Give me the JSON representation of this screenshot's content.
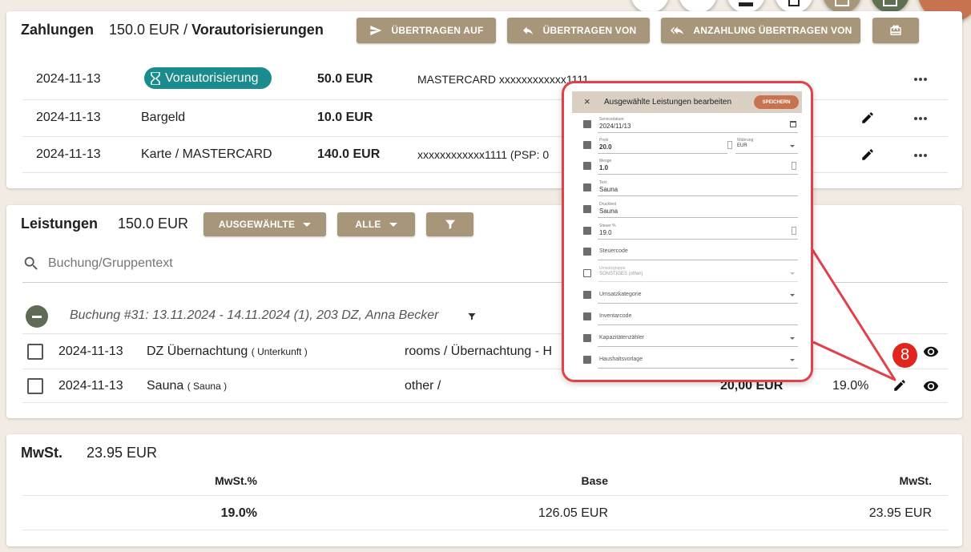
{
  "payments": {
    "title": "Zahlungen",
    "amount": "150.0 EUR",
    "separator": "/",
    "preauth_title": "Vorautorisierungen",
    "buttons": {
      "transfer_to": "ÜBERTRAGEN AUF",
      "transfer_from": "ÜBERTRAGEN VON",
      "deposit_from": "ANZAHLUNG ÜBERTRAGEN VON"
    },
    "rows": [
      {
        "date": "2024-11-13",
        "type": "Vorautorisierung",
        "amount": "50.0 EUR",
        "detail": "MASTERCARD xxxxxxxxxxxx1111"
      },
      {
        "date": "2024-11-13",
        "type": "Bargeld",
        "amount": "10.0 EUR",
        "detail": ""
      },
      {
        "date": "2024-11-13",
        "type": "Karte / MASTERCARD",
        "amount": "140.0 EUR",
        "detail": "xxxxxxxxxxxx1111 (PSP: 0"
      }
    ]
  },
  "services": {
    "title": "Leistungen",
    "amount": "150.0 EUR",
    "buttons": {
      "selected": "AUSGEWÄHLTE",
      "all": "ALLE"
    },
    "search_placeholder": "Buchung/Gruppentext",
    "group_title": "Buchung #31: 13.11.2024 - 14.11.2024 (1), 203 DZ, Anna Becker",
    "rows": [
      {
        "date": "2024-11-13",
        "name": "DZ Übernachtung",
        "sub": "( Unterkunft )",
        "category": "rooms / Übernachtung - H",
        "amount": "",
        "tax": ""
      },
      {
        "date": "2024-11-13",
        "name": "Sauna",
        "sub": "( Sauna )",
        "category": "other /",
        "amount": "20,00 EUR",
        "tax": "19.0%"
      }
    ]
  },
  "vat": {
    "title": "MwSt.",
    "amount": "23.95 EUR",
    "headers": [
      "MwSt.%",
      "Base",
      "MwSt."
    ],
    "row": [
      "19.0%",
      "126.05 EUR",
      "23.95 EUR"
    ]
  },
  "badge": "8",
  "popup": {
    "title": "Ausgewählte Leistungen bearbeiten",
    "close": "×",
    "save": "SPEICHERN",
    "fields": [
      {
        "label": "Servicedatum",
        "value": "2024/11/13",
        "checked": true
      },
      {
        "label": "Preis",
        "value": "20.0",
        "label2": "Währung",
        "value2": "EUR",
        "checked": true
      },
      {
        "label": "Menge",
        "value": "1.0",
        "checked": true
      },
      {
        "label": "Text",
        "value": "Sauna",
        "checked": true
      },
      {
        "label": "Drucktext",
        "value": "Sauna",
        "checked": true
      },
      {
        "label": "Steuer %",
        "value": "19.0",
        "checked": true
      },
      {
        "label": "Steuercode",
        "value": "",
        "checked": true
      },
      {
        "label": "Umsatzgruppe",
        "value": "SONSTIGES (other)",
        "checked": false
      },
      {
        "label": "Umsatzkategorie",
        "value": "",
        "checked": true
      },
      {
        "label": "Inventarcode",
        "value": "",
        "checked": true
      },
      {
        "label": "Kapazitätenzähler",
        "value": "",
        "checked": true
      },
      {
        "label": "Haushaltsvorlage",
        "value": "",
        "checked": true
      }
    ]
  }
}
